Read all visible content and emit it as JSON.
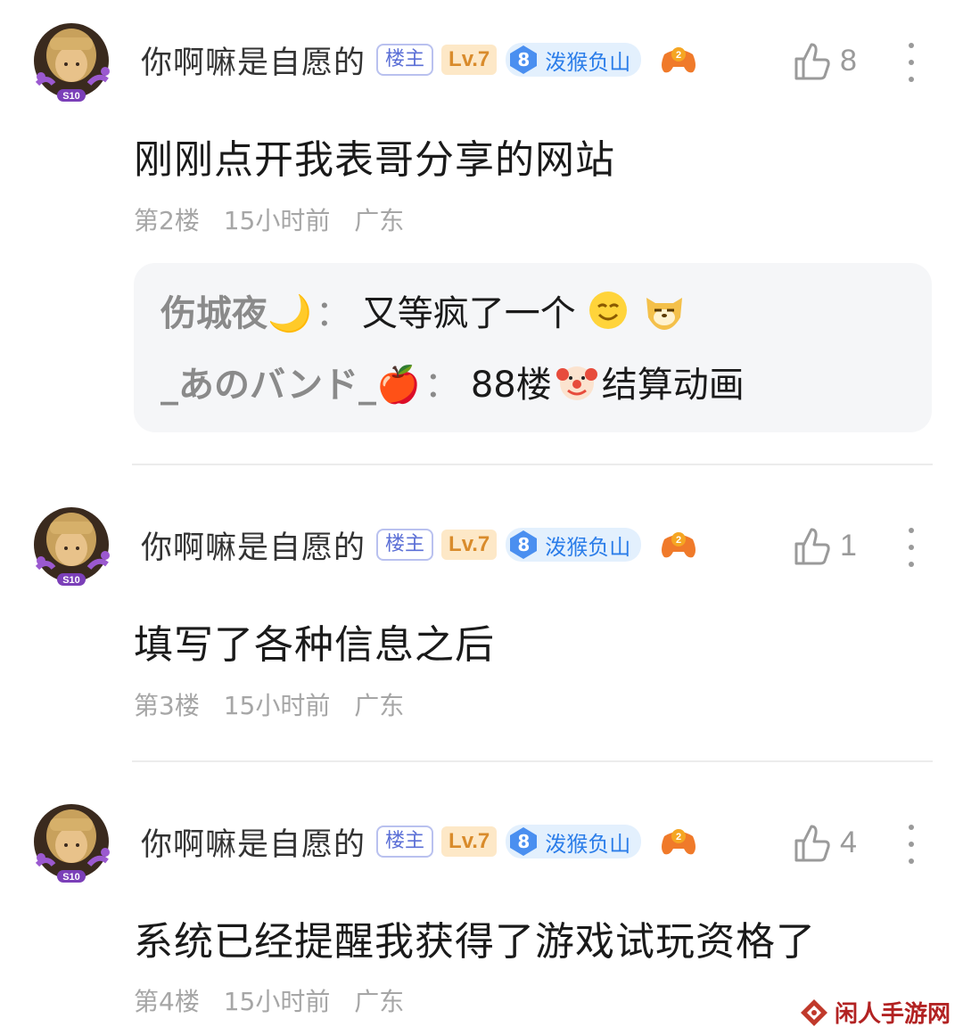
{
  "posts": [
    {
      "username": "你啊嘛是自愿的",
      "badge_owner": "楼主",
      "badge_level": "Lv.7",
      "fan_level": "8",
      "fan_name": "泼猴负山",
      "likes": "8",
      "content": "刚刚点开我表哥分享的网站",
      "floor": "第2楼",
      "time": "15小时前",
      "location": "广东"
    },
    {
      "username": "你啊嘛是自愿的",
      "badge_owner": "楼主",
      "badge_level": "Lv.7",
      "fan_level": "8",
      "fan_name": "泼猴负山",
      "likes": "1",
      "content": "填写了各种信息之后",
      "floor": "第3楼",
      "time": "15小时前",
      "location": "广东"
    },
    {
      "username": "你啊嘛是自愿的",
      "badge_owner": "楼主",
      "badge_level": "Lv.7",
      "fan_level": "8",
      "fan_name": "泼猴负山",
      "likes": "4",
      "content": "系统已经提醒我获得了游戏试玩资格了",
      "floor": "第4楼",
      "time": "15小时前",
      "location": "广东"
    }
  ],
  "replies": [
    {
      "name": "伤城夜🌙",
      "colon": "：",
      "text": "又等疯了一个"
    },
    {
      "name": "_あのバンド_🍎",
      "colon": "：",
      "text_before": "88楼",
      "text_after": "结算动画"
    }
  ],
  "watermark": "闲人手游网",
  "colors": {
    "owner_badge": "#5b6fd6",
    "level_badge": "#d98b2b",
    "fan_badge": "#2b7de9",
    "meta_text": "#a6a6a6"
  }
}
